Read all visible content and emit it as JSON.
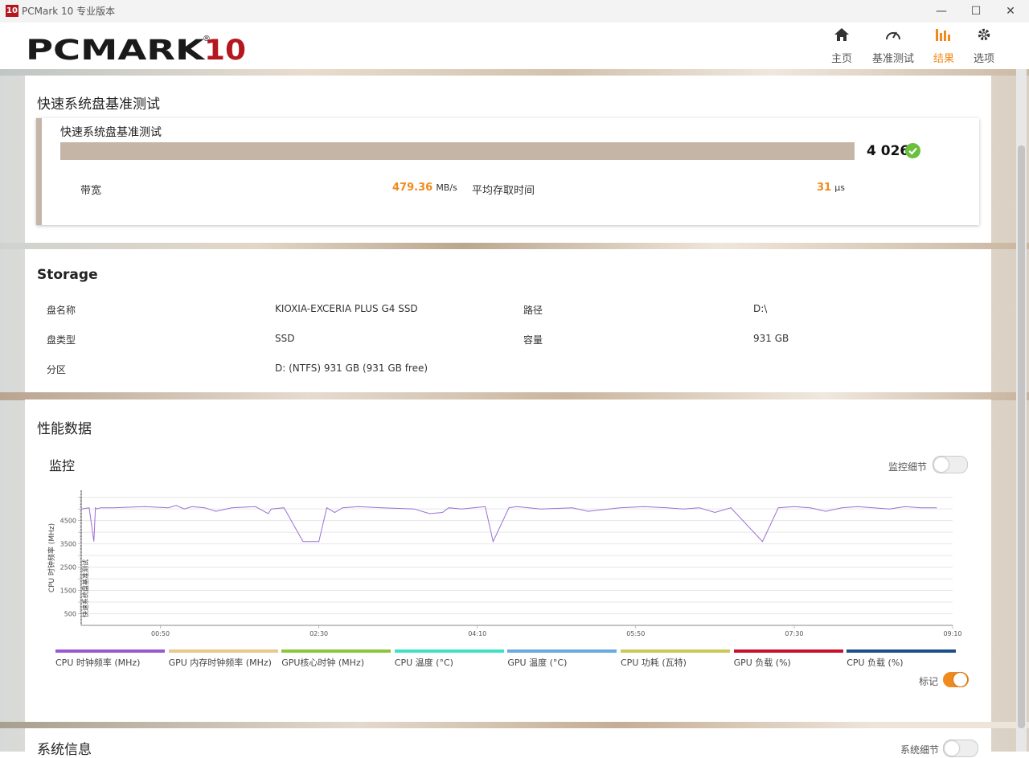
{
  "window": {
    "icon_text": "10",
    "title": "PCMark 10 专业版本",
    "controls": {
      "minimize": "—",
      "maximize": "☐",
      "close": "✕"
    }
  },
  "brand": {
    "logo_text": "PCMARK",
    "logo_num": "10",
    "logo_mark": "®"
  },
  "nav": [
    {
      "label": "主页",
      "icon": "home-icon"
    },
    {
      "label": "基准测试",
      "icon": "gauge-icon"
    },
    {
      "label": "结果",
      "icon": "bar-chart-icon",
      "active": true
    },
    {
      "label": "选项",
      "icon": "gear-icon"
    }
  ],
  "colors": {
    "accent": "#f18a1c",
    "score_bar": "#c4b5a7",
    "check": "#6abf3c",
    "line": "#9b6fd4"
  },
  "result": {
    "section_title": "快速系统盘基准测试",
    "test_name": "快速系统盘基准测试",
    "score": "4 026",
    "bandwidth_label": "带宽",
    "bandwidth_value": "479.36",
    "bandwidth_unit": "MB/s",
    "latency_label": "平均存取时间",
    "latency_value": "31",
    "latency_unit": "μs"
  },
  "storage": {
    "title": "Storage",
    "rows": [
      {
        "label": "盘名称",
        "value": "KIOXIA-EXCERIA PLUS G4 SSD",
        "label2": "路径",
        "value2": "D:\\"
      },
      {
        "label": "盘类型",
        "value": "SSD",
        "label2": "容量",
        "value2": "931 GB"
      },
      {
        "label": "分区",
        "value": "D: (NTFS) 931 GB (931 GB free)",
        "label2": "",
        "value2": ""
      }
    ]
  },
  "performance": {
    "title": "性能数据",
    "monitor_title": "监控",
    "monitor_detail_label": "监控细节",
    "markers_label": "标记",
    "legend": [
      {
        "name": "CPU 时钟频率 (MHz)",
        "color": "#9b59d0"
      },
      {
        "name": "GPU 内存时钟频率 (MHz)",
        "color": "#e8c98c"
      },
      {
        "name": "GPU核心时钟 (MHz)",
        "color": "#8cc63f"
      },
      {
        "name": "CPU 温度 (°C)",
        "color": "#3fe0c5"
      },
      {
        "name": "GPU 温度 (°C)",
        "color": "#6aa8e0"
      },
      {
        "name": "CPU 功耗 (瓦特)",
        "color": "#c9c95a"
      },
      {
        "name": "GPU 负载 (%)",
        "color": "#c8102e"
      },
      {
        "name": "CPU 负载 (%)",
        "color": "#1b4f8c"
      }
    ]
  },
  "system_info": {
    "title": "系统信息",
    "detail_label": "系统细节"
  },
  "chart_data": {
    "type": "line",
    "ylabel": "CPU 时钟频率 (MHz)",
    "marker_label": "快速系统盘基准测试",
    "x_tick_labels": [
      "00:50",
      "02:30",
      "04:10",
      "05:50",
      "07:30",
      "09:10"
    ],
    "y_tick_labels": [
      "500",
      "1500",
      "2500",
      "3500",
      "4500"
    ],
    "xlim_seconds": [
      0,
      550
    ],
    "ylim": [
      0,
      5800
    ],
    "series": [
      {
        "color": "#9b6fd4",
        "x": [
          0,
          5,
          8,
          9,
          10,
          12,
          20,
          40,
          55,
          60,
          65,
          70,
          78,
          85,
          95,
          110,
          118,
          120,
          128,
          140,
          150,
          155,
          160,
          165,
          175,
          190,
          210,
          220,
          228,
          232,
          240,
          255,
          260,
          270,
          275,
          290,
          310,
          320,
          340,
          355,
          370,
          380,
          390,
          400,
          410,
          430,
          440,
          450,
          460,
          470,
          480,
          490,
          500,
          510,
          520,
          530,
          540
        ],
        "y": [
          5000,
          5050,
          3600,
          5050,
          5000,
          5050,
          5050,
          5100,
          5050,
          5150,
          5000,
          5100,
          5050,
          4900,
          5050,
          5100,
          4800,
          5000,
          5050,
          3600,
          3600,
          5050,
          4850,
          5050,
          5100,
          5050,
          5000,
          4800,
          4850,
          5050,
          5000,
          5100,
          3600,
          5050,
          5100,
          5000,
          5050,
          4900,
          5050,
          5100,
          5050,
          5000,
          5050,
          4850,
          5050,
          3600,
          5050,
          5100,
          5050,
          4900,
          5050,
          5100,
          5050,
          5000,
          5100,
          5050,
          5050
        ]
      }
    ]
  }
}
